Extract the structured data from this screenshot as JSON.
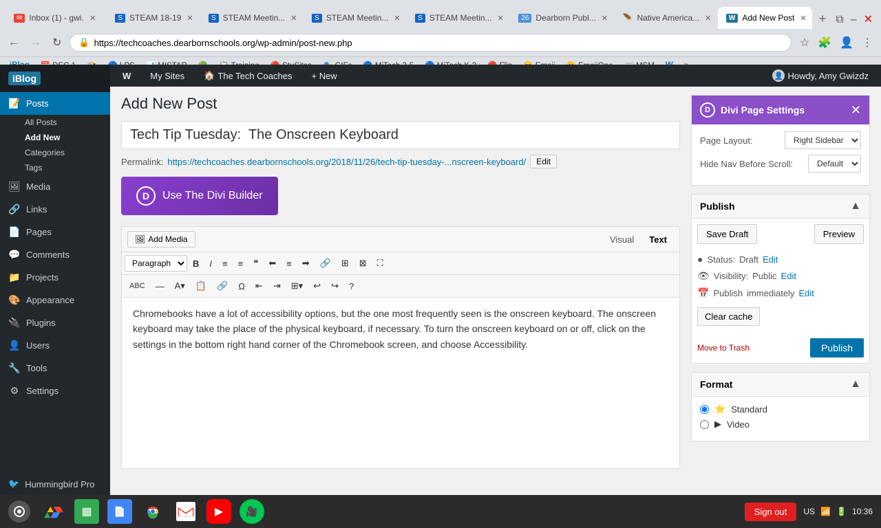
{
  "browser": {
    "tabs": [
      {
        "id": 1,
        "favicon": "✉",
        "favicon_color": "#ea4335",
        "label": "Inbox (1) - gwi...",
        "active": false
      },
      {
        "id": 2,
        "favicon": "S",
        "favicon_color": "#1565c0",
        "label": "STEAM 18-19",
        "active": false
      },
      {
        "id": 3,
        "favicon": "S",
        "favicon_color": "#1565c0",
        "label": "STEAM Meetin...",
        "active": false
      },
      {
        "id": 4,
        "favicon": "S",
        "favicon_color": "#1565c0",
        "label": "STEAM Meetin...",
        "active": false
      },
      {
        "id": 5,
        "favicon": "S",
        "favicon_color": "#1565c0",
        "label": "STEAM Meetin...",
        "active": false
      },
      {
        "id": 6,
        "favicon": "26",
        "favicon_color": "#4a90d9",
        "label": "Dearborn Publ...",
        "active": false
      },
      {
        "id": 7,
        "favicon": "🪶",
        "favicon_color": "#888",
        "label": "Native America...",
        "active": false
      },
      {
        "id": 8,
        "favicon": "W",
        "favicon_color": "#21759b",
        "label": "Add New Post",
        "active": true
      }
    ],
    "url": "https://techcoaches.dearbornschools.org/wp-admin/post-new.php",
    "bookmarks": [
      {
        "label": "DEC 1",
        "favicon": "📅"
      },
      {
        "label": "",
        "favicon": "📸"
      },
      {
        "label": "LPS",
        "favicon": "🔵"
      },
      {
        "label": "MISTAR",
        "favicon": "📊"
      },
      {
        "label": "",
        "favicon": "🟢"
      },
      {
        "label": "Training",
        "favicon": "📋"
      },
      {
        "label": "StuSites",
        "favicon": "🔴"
      },
      {
        "label": "",
        "favicon": "🟡"
      },
      {
        "label": "GIFs",
        "favicon": "🎭"
      },
      {
        "label": "MiTech 3-5",
        "favicon": "🔵"
      },
      {
        "label": "MiTech K-2",
        "favicon": "🔵"
      },
      {
        "label": "Flip",
        "favicon": "🔴"
      },
      {
        "label": "Emoji",
        "favicon": "😊"
      },
      {
        "label": "EmojiOne",
        "favicon": "😀"
      },
      {
        "label": "MSM",
        "favicon": "📰"
      },
      {
        "label": "",
        "favicon": "W"
      }
    ]
  },
  "admin_bar": {
    "logo": "iBlog",
    "my_sites": "My Sites",
    "site_name": "The Tech Coaches",
    "new": "+ New",
    "howdy": "Howdy, Amy Gwizdz"
  },
  "sidebar": {
    "items": [
      {
        "id": "posts",
        "icon": "📝",
        "label": "Posts",
        "active": true
      },
      {
        "id": "media",
        "icon": "🖼",
        "label": "Media"
      },
      {
        "id": "links",
        "icon": "🔗",
        "label": "Links"
      },
      {
        "id": "pages",
        "icon": "📄",
        "label": "Pages"
      },
      {
        "id": "comments",
        "icon": "💬",
        "label": "Comments"
      },
      {
        "id": "projects",
        "icon": "📁",
        "label": "Projects"
      },
      {
        "id": "appearance",
        "icon": "🎨",
        "label": "Appearance"
      },
      {
        "id": "plugins",
        "icon": "🔌",
        "label": "Plugins"
      },
      {
        "id": "users",
        "icon": "👤",
        "label": "Users"
      },
      {
        "id": "tools",
        "icon": "🔧",
        "label": "Tools"
      },
      {
        "id": "settings",
        "icon": "⚙",
        "label": "Settings"
      }
    ],
    "posts_sub": [
      {
        "label": "All Posts",
        "active": false
      },
      {
        "label": "Add New",
        "active": true
      },
      {
        "label": "Categories"
      },
      {
        "label": "Tags"
      }
    ],
    "bottom": "Hummingbird Pro"
  },
  "page": {
    "title": "Add New Post",
    "post_title": "Tech Tip Tuesday:  The Onscreen Keyboard",
    "permalink_prefix": "Permalink:",
    "permalink_url": "https://techcoaches.dearbornschools.org/2018/11/26/tech-tip-tuesday-...nscreen-keyboard/",
    "permalink_edit": "Edit",
    "divi_builder_label": "Use The Divi Builder",
    "add_media_label": "Add Media",
    "editor_tabs": [
      "Visual",
      "Text"
    ],
    "active_tab": "Visual",
    "content": "Chromebooks have a lot of accessibility options, but the one most frequently seen is the onscreen keyboard.  The onscreen keyboard may take the place of the physical keyboard, if necessary.  To turn the onscreen keyboard on or off, click on the settings in the bottom right hand corner of the Chromebook screen, and choose Accessibility.",
    "toolbar": {
      "paragraph_select": "Paragraph",
      "buttons": [
        "B",
        "I",
        "≡",
        "≡",
        "❝",
        "≡",
        "≡",
        "≡",
        "🔗",
        "⊞",
        "⊠",
        "↕",
        "⋮",
        "≡",
        "📧"
      ]
    }
  },
  "divi_settings": {
    "title": "Divi Page Settings",
    "page_layout_label": "Page Layout:",
    "page_layout_value": "Right Sidebar",
    "hide_nav_label": "Hide Nav Before Scroll:",
    "hide_nav_value": "Default"
  },
  "publish": {
    "title": "Publish",
    "save_draft": "Save Draft",
    "preview": "Preview",
    "status_label": "Status:",
    "status_value": "Draft",
    "status_edit": "Edit",
    "visibility_label": "Visibility:",
    "visibility_value": "Public",
    "visibility_edit": "Edit",
    "publish_label": "Publish",
    "publish_immediately": "immediately",
    "publish_edit": "Edit",
    "clear_cache": "Clear cache",
    "move_to_trash": "Move to Trash",
    "publish_btn": "Publish"
  },
  "format": {
    "title": "Format",
    "options": [
      {
        "id": "standard",
        "icon": "⭐",
        "label": "Standard",
        "selected": true
      },
      {
        "id": "video",
        "icon": "▶",
        "label": "Video",
        "selected": false
      }
    ]
  },
  "taskbar": {
    "system_btn": "⊙",
    "apps": [
      {
        "icon": "▲",
        "color": "#fbbc04",
        "label": "Drive"
      },
      {
        "icon": "▦",
        "color": "#34a853",
        "label": "Sheets"
      },
      {
        "icon": "📄",
        "color": "#4285f4",
        "label": "Docs"
      },
      {
        "icon": "●",
        "color": "#ea4335",
        "label": "Chrome"
      },
      {
        "icon": "✉",
        "color": "#ea4335",
        "label": "Gmail"
      },
      {
        "icon": "▶",
        "color": "#ff0000",
        "label": "YouTube"
      },
      {
        "icon": "🎥",
        "color": "#00c853",
        "label": "Meet"
      }
    ],
    "sign_out": "Sign out",
    "locale": "US",
    "time": "10:36"
  }
}
